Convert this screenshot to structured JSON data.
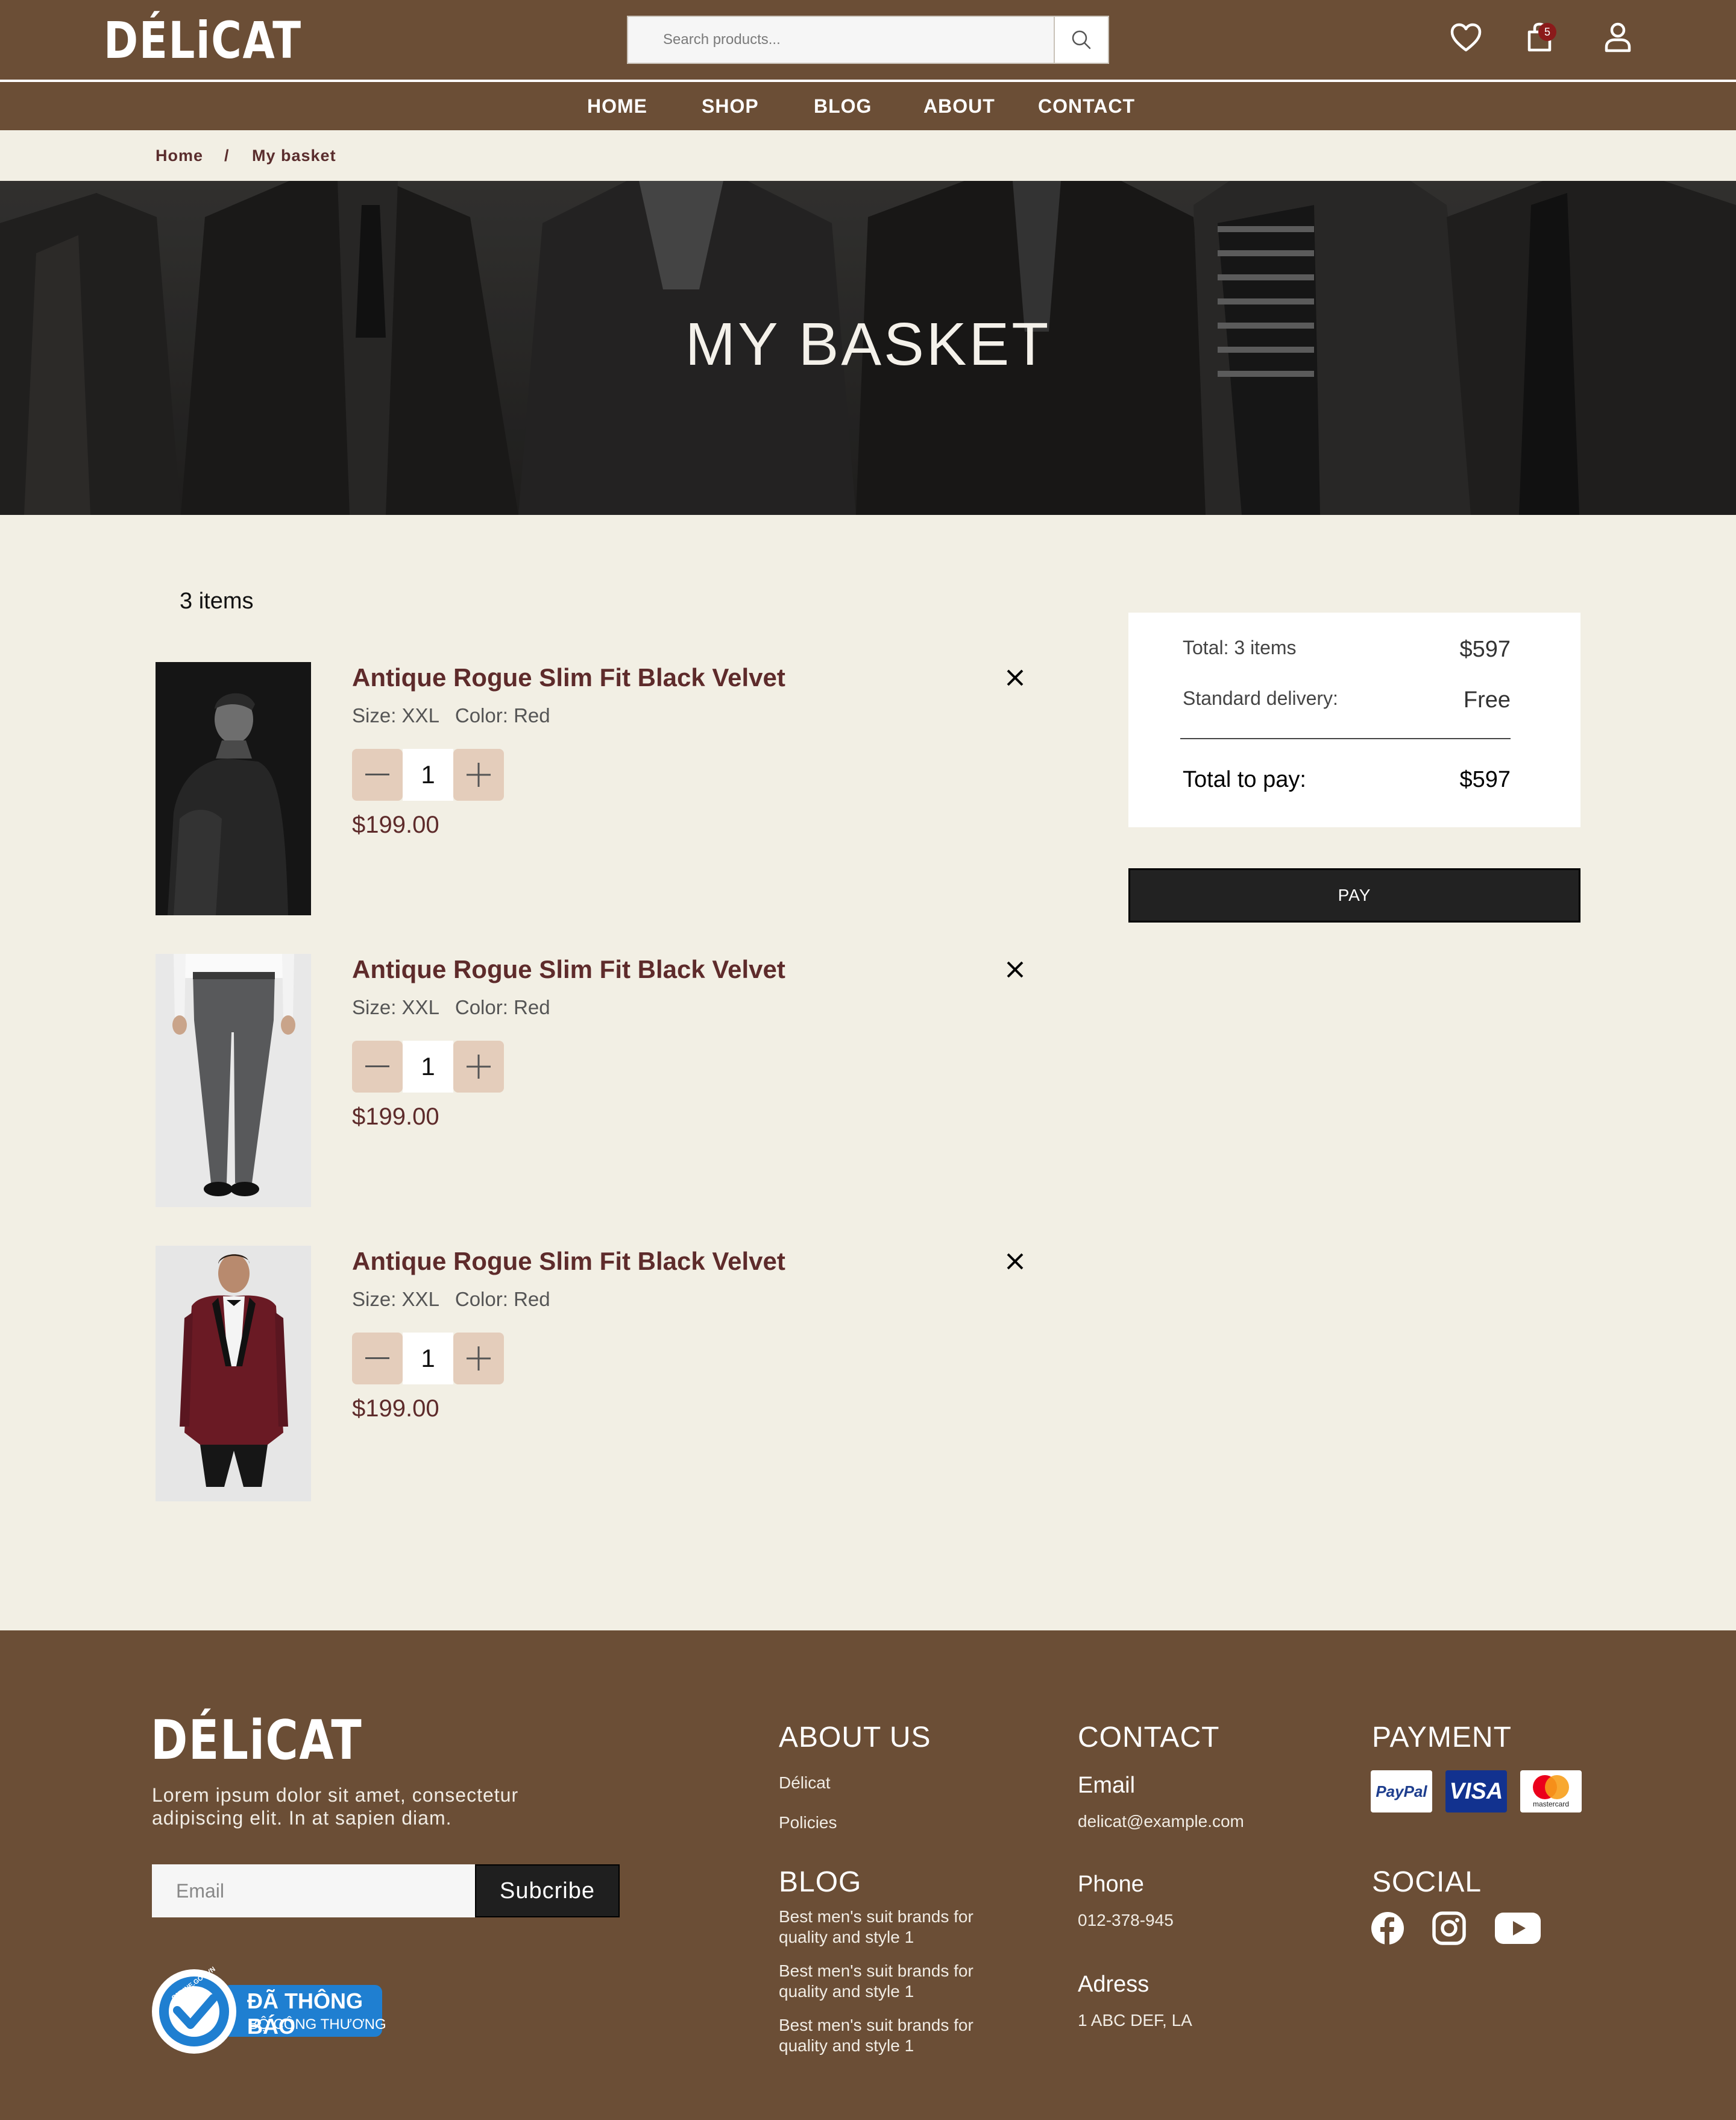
{
  "brand": {
    "logo": "DÉLiCAT"
  },
  "header": {
    "search_placeholder": "Search products...",
    "cart_count": "5",
    "nav": [
      "HOME",
      "SHOP",
      "BLOG",
      "ABOUT",
      "CONTACT"
    ]
  },
  "breadcrumb": {
    "home": "Home",
    "separator": "/",
    "current": "My basket"
  },
  "hero": {
    "title": "MY BASKET"
  },
  "basket": {
    "count_label": "3 items",
    "items": [
      {
        "name": "Antique Rogue Slim Fit Black Velvet",
        "size_label": "Size:",
        "size": "XXL",
        "color_label": "Color:",
        "color": "Red",
        "quantity": "1",
        "price": "$199.00"
      },
      {
        "name": "Antique Rogue Slim Fit Black Velvet",
        "size_label": "Size:",
        "size": "XXL",
        "color_label": "Color:",
        "color": "Red",
        "quantity": "1",
        "price": "$199.00"
      },
      {
        "name": "Antique Rogue Slim Fit Black Velvet",
        "size_label": "Size:",
        "size": "XXL",
        "color_label": "Color:",
        "color": "Red",
        "quantity": "1",
        "price": "$199.00"
      }
    ]
  },
  "summary": {
    "total_label": "Total: 3 items",
    "total_value": "$597",
    "delivery_label": "Standard delivery:",
    "delivery_value": "Free",
    "pay_total_label": "Total to pay:",
    "pay_total_value": "$597",
    "pay_button": "PAY"
  },
  "footer": {
    "description": "Lorem ipsum dolor sit amet, consectetur adipiscing elit. In at sapien diam.",
    "email_placeholder": "Email",
    "subscribe_button": "Subcribe",
    "about": {
      "heading": "ABOUT US",
      "links": [
        "Délicat",
        "Policies"
      ]
    },
    "blog": {
      "heading": "BLOG",
      "links": [
        "Best men's suit brands for quality and style 1",
        "Best men's suit brands for quality and style 1",
        "Best men's suit brands for quality and style 1"
      ]
    },
    "contact": {
      "heading": "CONTACT",
      "email_label": "Email",
      "email": "delicat@example.com",
      "phone_label": "Phone",
      "phone": "012-378-945",
      "address_label": "Adress",
      "address": "1 ABC DEF, LA"
    },
    "payment": {
      "heading": "PAYMENT",
      "cards": [
        "PayPal",
        "VISA",
        "mastercard"
      ]
    },
    "social": {
      "heading": "SOCIAL",
      "icons": [
        "facebook-icon",
        "instagram-icon",
        "youtube-icon"
      ]
    },
    "gov_badge": {
      "title": "ĐÃ THÔNG BÁO",
      "subtitle": "BỘ CÔNG THƯƠNG",
      "ring_text": "ONLINE.GOV.VN"
    }
  },
  "colors": {
    "brown": "#6b4e36",
    "cream": "#f2efe4",
    "maroon": "#5e2b2b",
    "qty_bg": "#e4cdbb",
    "dark": "#222222"
  }
}
